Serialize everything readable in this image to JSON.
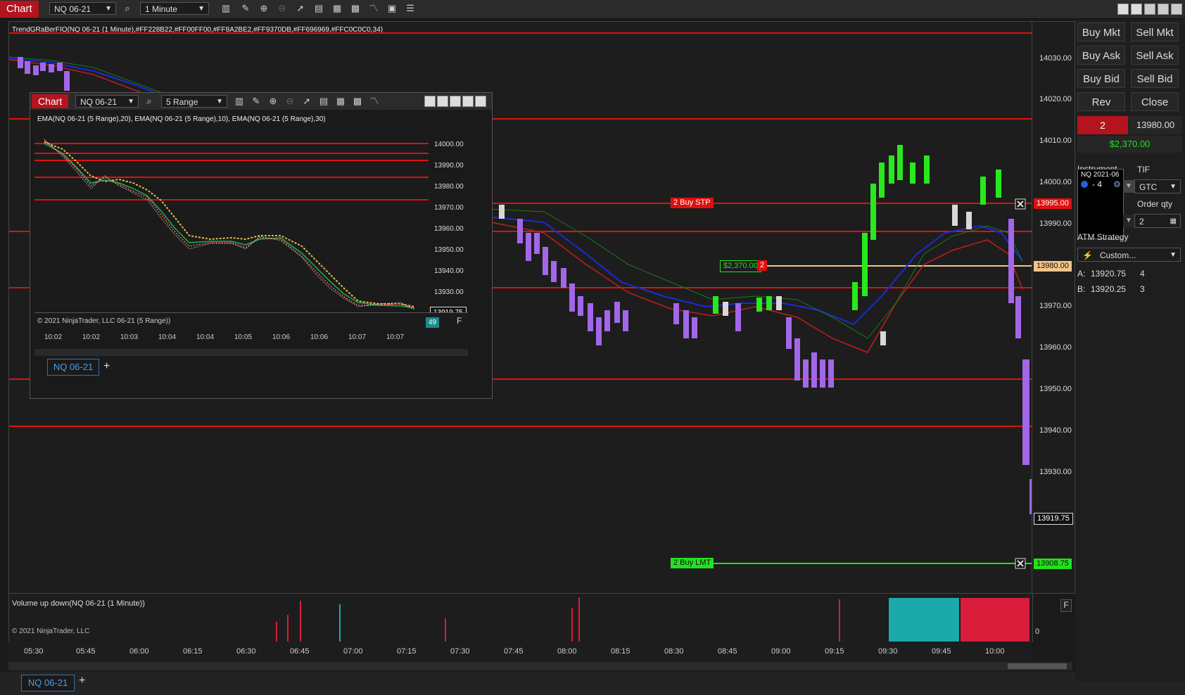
{
  "toolbar": {
    "chart_tab": "Chart",
    "instrument": "NQ 06-21",
    "interval": "1 Minute"
  },
  "main_chart": {
    "indicator_label": "TrendGRaBerFIO(NQ 06-21 (1 Minute),#FF228B22,#FF00FF00,#FF8A2BE2,#FF9370DB,#FF696969,#FFC0C0C0,34)",
    "price_axis": [
      "14030.00",
      "14020.00",
      "14010.00",
      "14000.00",
      "13990.00",
      "13970.00",
      "13960.00",
      "13950.00",
      "13940.00",
      "13930.00"
    ],
    "time_axis": [
      "05:30",
      "05:45",
      "06:00",
      "06:15",
      "06:30",
      "06:45",
      "07:00",
      "07:15",
      "07:30",
      "07:45",
      "08:00",
      "08:15",
      "08:30",
      "08:45",
      "09:00",
      "09:15",
      "09:30",
      "09:45",
      "10:00"
    ],
    "buy_stp_label": "2  Buy STP",
    "buy_stp_price": "13995.00",
    "position_pnl": "$2,370.00",
    "position_qty": "2",
    "position_price": "13980.00",
    "last_price": "13919.75",
    "buy_lmt_label": "2  Buy LMT",
    "buy_lmt_price": "13908.75",
    "volume_label": "Volume up down(NQ 06-21 (1 Minute))",
    "volume_zero": "0",
    "copyright": "© 2021 NinjaTrader, LLC",
    "tab_instrument": "NQ 06-21",
    "tab_add": "+",
    "f_label": "F"
  },
  "order_panel": {
    "buy_mkt": "Buy Mkt",
    "sell_mkt": "Sell Mkt",
    "buy_ask": "Buy Ask",
    "sell_ask": "Sell Ask",
    "buy_bid": "Buy Bid",
    "sell_bid": "Sell Bid",
    "rev": "Rev",
    "close": "Close",
    "position_qty": "2",
    "position_price": "13980.00",
    "pnl": "$2,370.00",
    "instrument_label": "Instrument",
    "instrument_popup": "NQ 2021-06",
    "instrument_offset": "- 4",
    "tif_label": "TIF",
    "tif_value": "GTC",
    "order_qty_label": "Order qty",
    "order_qty_value": "2",
    "atm_label": "ATM Strategy",
    "atm_value": "Custom...",
    "ask_label": "A:",
    "ask_price": "13920.75",
    "ask_size": "4",
    "bid_label": "B:",
    "bid_price": "13920.25",
    "bid_size": "3"
  },
  "inner_chart": {
    "chart_tab": "Chart",
    "instrument": "NQ 06-21",
    "interval": "5 Range",
    "indicator_label": "EMA(NQ 06-21 (5 Range),20), EMA(NQ 06-21 (5 Range),10), EMA(NQ 06-21 (5 Range),30)",
    "price_axis": [
      "14000.00",
      "13990.00",
      "13980.00",
      "13970.00",
      "13960.00",
      "13950.00",
      "13940.00",
      "13930.00"
    ],
    "last_price": "13919.75",
    "time_axis": [
      "10:02",
      "10:02",
      "10:03",
      "10:04",
      "10:04",
      "10:05",
      "10:06",
      "10:06",
      "10:07",
      "10:07"
    ],
    "volume_label": "© 2021 NinjaTrader, LLC 06-21 (5 Range))",
    "volume_value": "49",
    "tab_instrument": "NQ 06-21",
    "tab_add": "+",
    "f_label": "F"
  }
}
